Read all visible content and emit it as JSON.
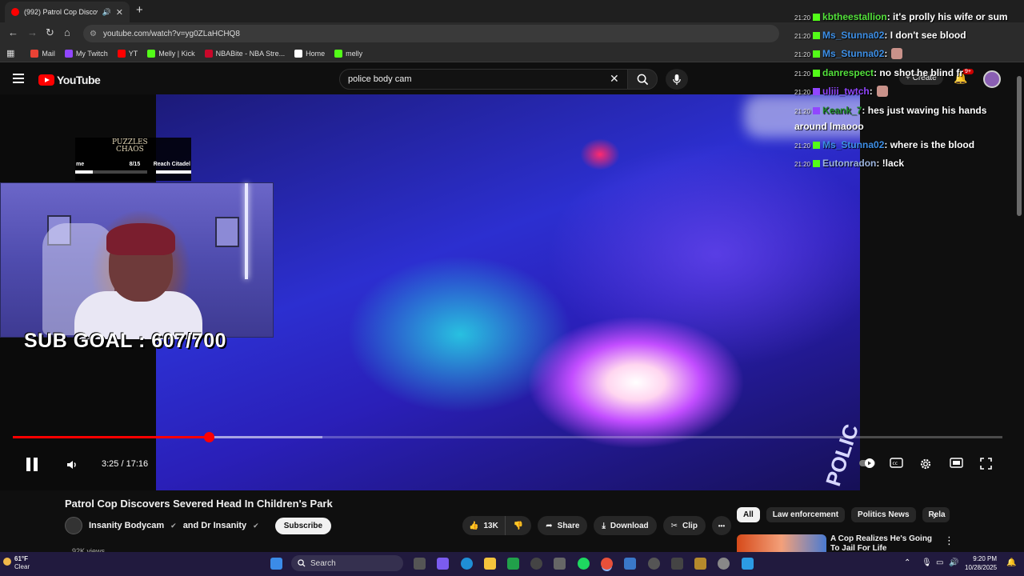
{
  "browser": {
    "tab_title": "(992) Patrol Cop Discovers",
    "tab_close": "✕",
    "new_tab": "+",
    "url": "youtube.com/watch?v=yg0ZLaHCHQ8",
    "bookmarks": [
      {
        "label": "Mail",
        "color": "#ea4335"
      },
      {
        "label": "My Twitch",
        "color": "#9146ff"
      },
      {
        "label": "YT",
        "color": "#ff0000"
      },
      {
        "label": "Melly | Kick",
        "color": "#53fc18"
      },
      {
        "label": "NBABite - NBA Stre...",
        "color": "#c9082a"
      },
      {
        "label": "Home",
        "color": "#ffffff"
      },
      {
        "label": "melly",
        "color": "#53fc18"
      }
    ]
  },
  "youtube": {
    "logo_text": "YouTube",
    "search_query": "police body cam",
    "create_label": "Create",
    "notification_count": "9+",
    "accent": "#ff0000"
  },
  "overlay": {
    "puzzles_logo_line1": "PUZZLES",
    "puzzles_logo_line2": "CHAOS",
    "puzzle_left": "me",
    "puzzle_count": "8/15",
    "puzzle_right": "Reach Citadel",
    "sub_goal": "SUB GOAL : 607/700",
    "police_text": "POLIC"
  },
  "player": {
    "time": "3:25 / 17:16",
    "progress_fraction": 0.198,
    "buffer_fraction": 0.313
  },
  "video": {
    "title": "Patrol Cop Discovers Severed Head In Children's Park",
    "channel": "Insanity Bodycam",
    "channel_and": "and Dr Insanity",
    "subscribe": "Subscribe",
    "likes": "13K",
    "share": "Share",
    "download": "Download",
    "clip": "Clip",
    "more": "•••",
    "description_partial": "92K views ..."
  },
  "recommendations": {
    "chips": [
      "All",
      "Law enforcement",
      "Politics News",
      "Rela"
    ],
    "item_title": "A Cop Realizes He's Going To Jail For Life"
  },
  "chat": [
    {
      "time": "21:20",
      "user": "kbtheestallion",
      "color": "#53e03b",
      "badge": "#53fc18",
      "text": ": it's prolly his wife or sum"
    },
    {
      "time": "21:20",
      "user": "Ms_Stunna02",
      "color": "#3d8fe6",
      "badge": "#53fc18",
      "text": ": I don't see blood"
    },
    {
      "time": "21:20",
      "user": "Ms_Stunna02",
      "color": "#3d8fe6",
      "badge": "#53fc18",
      "text": ":"
    },
    {
      "time": "21:20",
      "user": "danrespect",
      "color": "#53e03b",
      "badge": "#53fc18",
      "text": ": no shot he blind fr"
    },
    {
      "time": "21:20",
      "user": "uliii_twtch",
      "color": "#9146ff",
      "badge": "#9146ff",
      "text": ":"
    },
    {
      "time": "21:20",
      "user": "Keank_7",
      "color": "#1f8b2a",
      "badge": "#9146ff",
      "text": ": hes just waving his hands around lmaooo"
    },
    {
      "time": "21:20",
      "user": "Ms_Stunna02",
      "color": "#3d8fe6",
      "badge": "#53fc18",
      "text": ": where is the blood"
    },
    {
      "time": "21:20",
      "user": "Eutonradon",
      "color": "#9db6e0",
      "badge": "#53fc18",
      "text": ": !lack"
    }
  ],
  "taskbar": {
    "temp": "61°F",
    "condition": "Clear",
    "search": "Search",
    "time": "9:20 PM",
    "date": "10/28/2025"
  }
}
